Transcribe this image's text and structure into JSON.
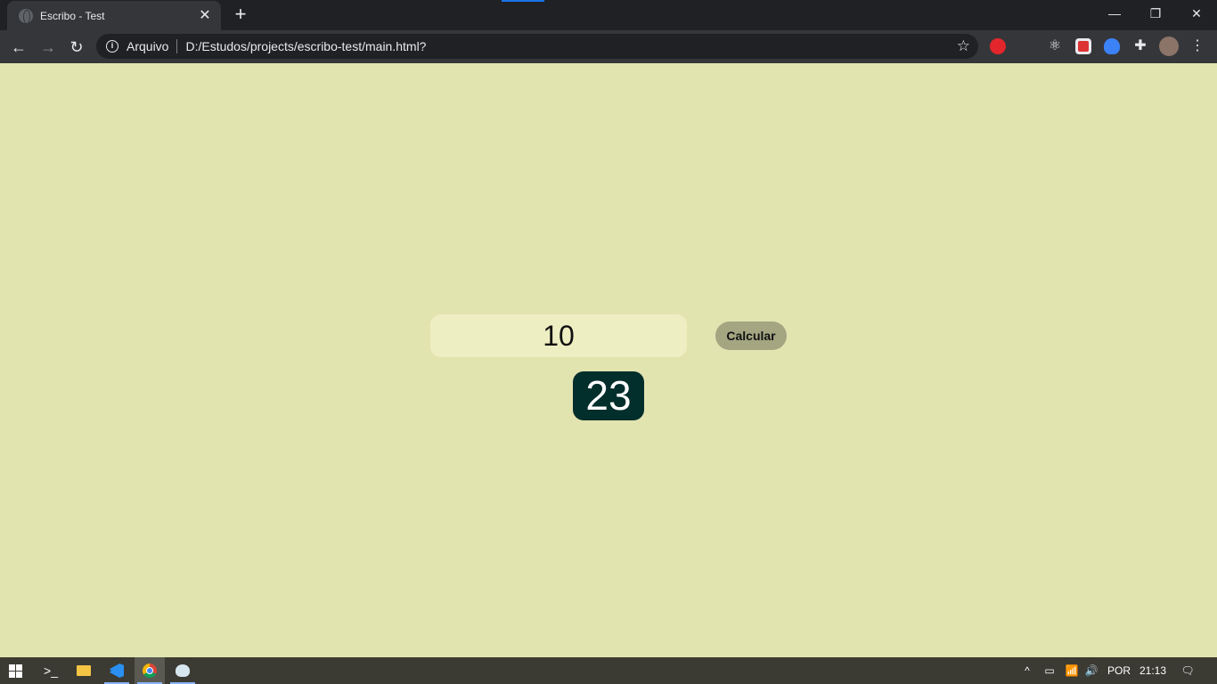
{
  "browser": {
    "tab": {
      "title": "Escribo - Test",
      "close": "✕",
      "favicon": "globe-icon"
    },
    "new_tab": "+",
    "window_controls": {
      "minimize": "—",
      "restore": "❐",
      "close": "✕"
    },
    "nav": {
      "back": "←",
      "forward": "→",
      "reload": "↻"
    },
    "omnibox": {
      "security_chip": "Arquivo",
      "info_icon": "i",
      "url": "D:/Estudos/projects/escribo-test/main.html?",
      "star": "☆"
    },
    "extensions": [
      "adblock-icon",
      "react-devtools-icon",
      "red-extension-icon",
      "shield-extension-icon",
      "puzzle-icon",
      "avatar",
      "menu-icon"
    ],
    "extension_glyphs": {
      "react": "⚛",
      "puzzle": "✚",
      "menu": "⋮"
    }
  },
  "page": {
    "input_value": "10",
    "calculate_label": "Calcular",
    "result": "23",
    "colors": {
      "background": "#e2e4b0",
      "input_bg": "#eeeec3",
      "button_bg": "#a3a681",
      "result_bg": "#022e2c"
    }
  },
  "taskbar": {
    "apps": [
      "start-icon",
      "terminal-icon",
      "file-explorer-icon",
      "vscode-icon",
      "chrome-icon",
      "paint-icon"
    ],
    "tray": {
      "chevron": "^",
      "language": "POR",
      "time": "21:13",
      "volume": "🔊",
      "network": "📶",
      "battery": "▭",
      "notifications": "🗨"
    }
  }
}
